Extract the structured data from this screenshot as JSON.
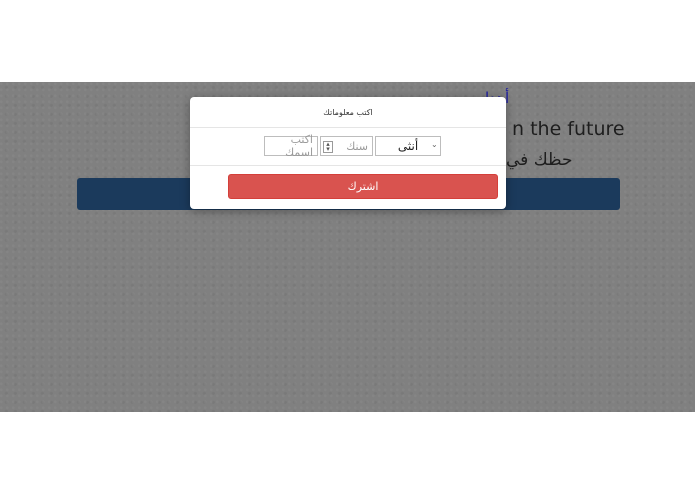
{
  "background": {
    "link_text": "أهدا",
    "line1": "n the future",
    "line2": "حظك في"
  },
  "modal": {
    "title": "اكتب معلوماتك",
    "name_placeholder": "اكتب اسمك",
    "age_placeholder": "سنك",
    "gender_selected": "أنثى",
    "subscribe_label": "اشترك"
  },
  "colors": {
    "overlay": "#808080",
    "bar": "#1b3a5c",
    "button": "#d9534f"
  }
}
